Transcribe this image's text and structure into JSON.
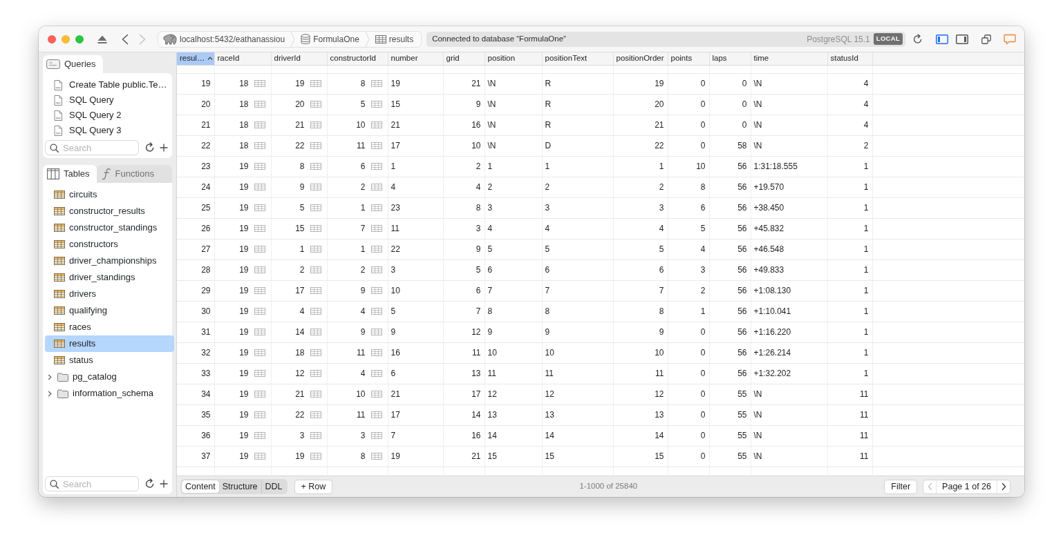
{
  "window": {
    "navigation": {
      "back_disabled": false,
      "forward_disabled": true
    },
    "breadcrumbs": [
      {
        "kind": "server",
        "label": "localhost:5432/eathanassiou"
      },
      {
        "kind": "database",
        "label": "FormulaOne"
      },
      {
        "kind": "table",
        "label": "results"
      }
    ],
    "status": {
      "message": "Connected to database “FormulaOne”",
      "server_version": "PostgreSQL 15.1",
      "badge": "LOCAL"
    },
    "panel_toggles": [
      {
        "kind": "left",
        "on": true
      },
      {
        "kind": "right",
        "on": false
      }
    ]
  },
  "sidebar": {
    "queries": {
      "tab": "Queries",
      "items": [
        "Create Table public.Te…",
        "SQL Query",
        "SQL Query 2",
        "SQL Query 3"
      ],
      "search": {
        "placeholder": "Search"
      }
    },
    "object_tabs": [
      {
        "kind": "tables",
        "label": "Tables",
        "selected": true
      },
      {
        "kind": "functions",
        "label": "Functions",
        "selected": false
      }
    ],
    "objects": [
      {
        "kind": "table",
        "label": "circuits",
        "selected": false
      },
      {
        "kind": "table",
        "label": "constructor_results",
        "selected": false
      },
      {
        "kind": "table",
        "label": "constructor_standings",
        "selected": false
      },
      {
        "kind": "table",
        "label": "constructors",
        "selected": false
      },
      {
        "kind": "table",
        "label": "driver_championships",
        "selected": false
      },
      {
        "kind": "table",
        "label": "driver_standings",
        "selected": false
      },
      {
        "kind": "table",
        "label": "drivers",
        "selected": false
      },
      {
        "kind": "table",
        "label": "qualifying",
        "selected": false
      },
      {
        "kind": "table",
        "label": "races",
        "selected": false
      },
      {
        "kind": "table",
        "label": "results",
        "selected": true
      },
      {
        "kind": "table",
        "label": "status",
        "selected": false
      },
      {
        "kind": "schema",
        "label": "pg_catalog",
        "selected": false,
        "expanded": false
      },
      {
        "kind": "schema",
        "label": "information_schema",
        "selected": false,
        "expanded": false
      }
    ],
    "search": {
      "placeholder": "Search"
    }
  },
  "table": {
    "columns": [
      {
        "name": "resul…",
        "kind": "numeric",
        "selected": true
      },
      {
        "name": "raceId",
        "kind": "reference",
        "selected": false
      },
      {
        "name": "driverId",
        "kind": "reference",
        "selected": false
      },
      {
        "name": "constructorId",
        "kind": "reference",
        "selected": false
      },
      {
        "name": "number",
        "kind": "text",
        "selected": false
      },
      {
        "name": "grid",
        "kind": "numeric",
        "selected": false
      },
      {
        "name": "position",
        "kind": "text",
        "selected": false
      },
      {
        "name": "positionText",
        "kind": "text",
        "selected": false
      },
      {
        "name": "positionOrder",
        "kind": "numeric",
        "selected": false
      },
      {
        "name": "points",
        "kind": "numeric",
        "selected": false
      },
      {
        "name": "laps",
        "kind": "numeric",
        "selected": false
      },
      {
        "name": "time",
        "kind": "text",
        "selected": false
      },
      {
        "name": "statusId",
        "kind": "numeric",
        "selected": false
      }
    ],
    "rows": [
      [
        "19",
        "18",
        "19",
        "8",
        "19",
        "21",
        "\\N",
        "R",
        "19",
        "0",
        "0",
        "\\N",
        "4"
      ],
      [
        "20",
        "18",
        "20",
        "5",
        "15",
        "9",
        "\\N",
        "R",
        "20",
        "0",
        "0",
        "\\N",
        "4"
      ],
      [
        "21",
        "18",
        "21",
        "10",
        "21",
        "16",
        "\\N",
        "R",
        "21",
        "0",
        "0",
        "\\N",
        "4"
      ],
      [
        "22",
        "18",
        "22",
        "11",
        "17",
        "10",
        "\\N",
        "D",
        "22",
        "0",
        "58",
        "\\N",
        "2"
      ],
      [
        "23",
        "19",
        "8",
        "6",
        "1",
        "2",
        "1",
        "1",
        "1",
        "10",
        "56",
        "1:31:18.555",
        "1"
      ],
      [
        "24",
        "19",
        "9",
        "2",
        "4",
        "4",
        "2",
        "2",
        "2",
        "8",
        "56",
        "+19.570",
        "1"
      ],
      [
        "25",
        "19",
        "5",
        "1",
        "23",
        "8",
        "3",
        "3",
        "3",
        "6",
        "56",
        "+38.450",
        "1"
      ],
      [
        "26",
        "19",
        "15",
        "7",
        "11",
        "3",
        "4",
        "4",
        "4",
        "5",
        "56",
        "+45.832",
        "1"
      ],
      [
        "27",
        "19",
        "1",
        "1",
        "22",
        "9",
        "5",
        "5",
        "5",
        "4",
        "56",
        "+46.548",
        "1"
      ],
      [
        "28",
        "19",
        "2",
        "2",
        "3",
        "5",
        "6",
        "6",
        "6",
        "3",
        "56",
        "+49.833",
        "1"
      ],
      [
        "29",
        "19",
        "17",
        "9",
        "10",
        "6",
        "7",
        "7",
        "7",
        "2",
        "56",
        "+1:08.130",
        "1"
      ],
      [
        "30",
        "19",
        "4",
        "4",
        "5",
        "7",
        "8",
        "8",
        "8",
        "1",
        "56",
        "+1:10.041",
        "1"
      ],
      [
        "31",
        "19",
        "14",
        "9",
        "9",
        "12",
        "9",
        "9",
        "9",
        "0",
        "56",
        "+1:16.220",
        "1"
      ],
      [
        "32",
        "19",
        "18",
        "11",
        "16",
        "11",
        "10",
        "10",
        "10",
        "0",
        "56",
        "+1:26.214",
        "1"
      ],
      [
        "33",
        "19",
        "12",
        "4",
        "6",
        "13",
        "11",
        "11",
        "11",
        "0",
        "56",
        "+1:32.202",
        "1"
      ],
      [
        "34",
        "19",
        "21",
        "10",
        "21",
        "17",
        "12",
        "12",
        "12",
        "0",
        "55",
        "\\N",
        "11"
      ],
      [
        "35",
        "19",
        "22",
        "11",
        "17",
        "14",
        "13",
        "13",
        "13",
        "0",
        "55",
        "\\N",
        "11"
      ],
      [
        "36",
        "19",
        "3",
        "3",
        "7",
        "16",
        "14",
        "14",
        "14",
        "0",
        "55",
        "\\N",
        "11"
      ],
      [
        "37",
        "19",
        "19",
        "8",
        "19",
        "21",
        "15",
        "15",
        "15",
        "0",
        "55",
        "\\N",
        "11"
      ]
    ]
  },
  "footer": {
    "views": [
      {
        "label": "Content",
        "selected": true
      },
      {
        "label": "Structure",
        "selected": false
      },
      {
        "label": "DDL",
        "selected": false
      }
    ],
    "add_row": "+ Row",
    "record_count": "1-1000 of 25840",
    "filter": "Filter",
    "pager": {
      "label": "Page 1 of 26",
      "prev_disabled": true,
      "next_disabled": false
    }
  }
}
